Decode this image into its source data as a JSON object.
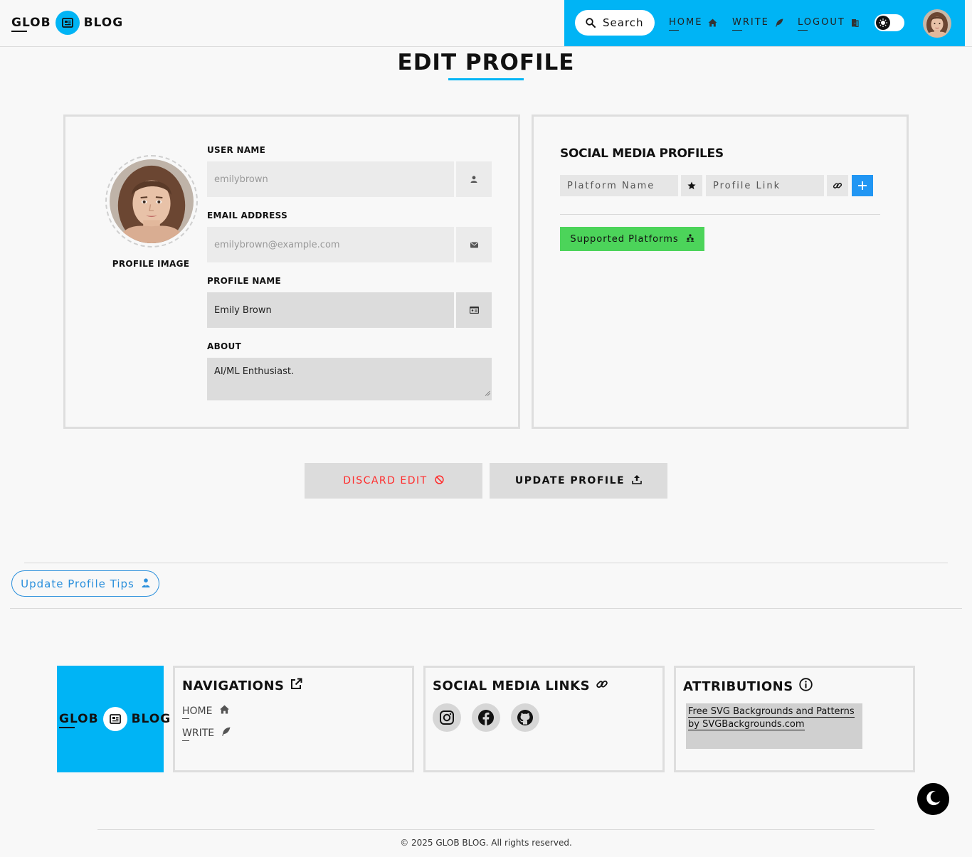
{
  "header": {
    "logo_left": "GLOB",
    "logo_right": "BLOG",
    "search_label": "Search",
    "nav": {
      "home": "HOME",
      "write": "WRITE",
      "logout": "LOGOUT"
    }
  },
  "page_title": "EDIT PROFILE",
  "profile": {
    "image_label": "PROFILE IMAGE",
    "username_label": "USER NAME",
    "username_value": "emilybrown",
    "email_label": "EMAIL ADDRESS",
    "email_value": "emilybrown@example.com",
    "profile_name_label": "PROFILE NAME",
    "profile_name_value": "Emily Brown",
    "about_label": "ABOUT",
    "about_value": "AI/ML Enthusiast."
  },
  "social": {
    "title": "SOCIAL MEDIA PROFILES",
    "platform_placeholder": "Platform Name",
    "link_placeholder": "Profile Link",
    "supported_label": "Supported Platforms"
  },
  "actions": {
    "discard": "DISCARD EDIT",
    "update": "UPDATE PROFILE"
  },
  "tips_label": "Update Profile Tips",
  "footer": {
    "logo_left": "GLOB",
    "logo_right": "BLOG",
    "navigations_title": "NAVIGATIONS",
    "nav_home": "HOME",
    "nav_write": "WRITE",
    "social_title": "SOCIAL MEDIA LINKS",
    "social_icons": [
      "instagram-icon",
      "facebook-icon",
      "github-icon"
    ],
    "attributions_title": "ATTRIBUTIONS",
    "attribution_text": "Free SVG Backgrounds and Patterns by SVGBackgrounds.com",
    "copyright": "© 2025 GLOB BLOG. All rights reserved."
  },
  "colors": {
    "accent": "#00b4f5",
    "discard": "#ff2b2b",
    "add_button": "#2196f3",
    "supported": "#4cd45a",
    "tips": "#2a8fdc"
  }
}
